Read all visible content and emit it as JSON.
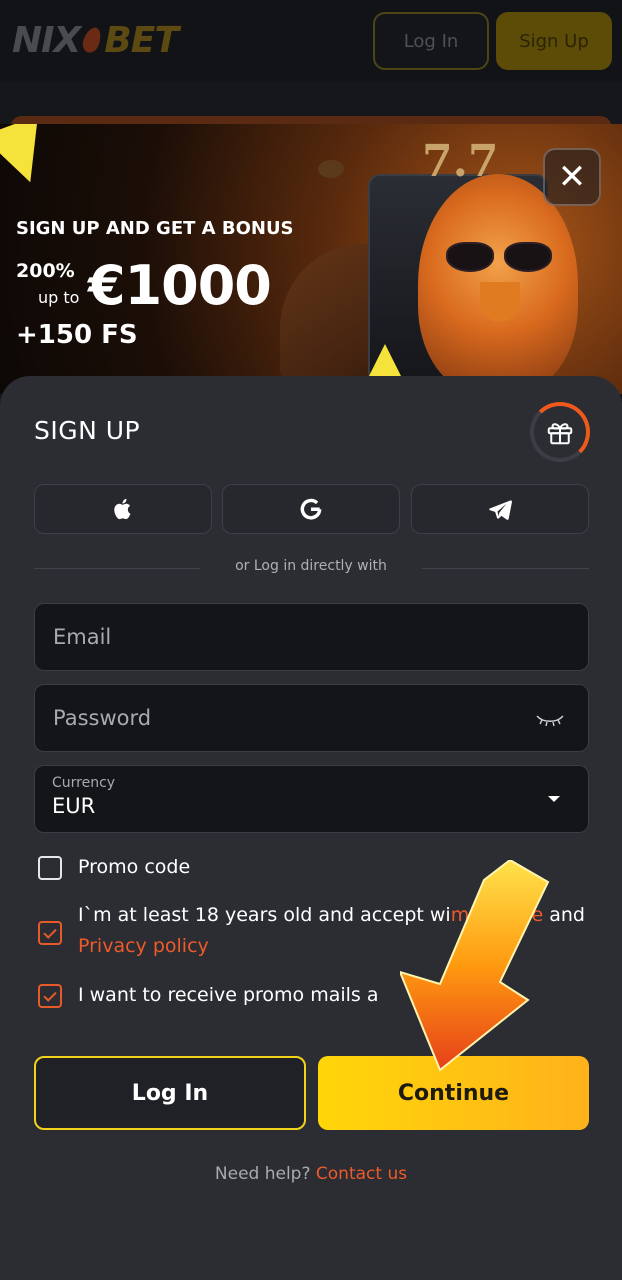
{
  "header": {
    "logo_part1": "NIX",
    "logo_part2": "BET",
    "login_label": "Log In",
    "signup_label": "Sign Up"
  },
  "banner": {
    "headline": "SIGN UP AND GET A BONUS",
    "percent": "200%",
    "up_to": "up to",
    "amount": "€1000",
    "free_spins": "+150 FS",
    "close_icon": "close-icon"
  },
  "signup": {
    "title": "SIGN UP",
    "gift_icon": "gift-icon",
    "social": [
      {
        "name": "apple",
        "icon": "apple-icon"
      },
      {
        "name": "google",
        "icon": "google-icon"
      },
      {
        "name": "telegram",
        "icon": "telegram-icon"
      }
    ],
    "divider_text": "or Log in directly with",
    "email": {
      "placeholder": "Email",
      "value": ""
    },
    "password": {
      "placeholder": "Password",
      "value": "",
      "toggle_icon": "eye-closed-icon"
    },
    "currency": {
      "label": "Currency",
      "value": "EUR"
    },
    "promo_code": {
      "label": "Promo code",
      "checked": false
    },
    "age_terms": {
      "text_before": "I`m at least 18 years old and accept wi",
      "link1": "ms of use",
      "text_mid": " and ",
      "link2": "Privacy policy",
      "checked": true
    },
    "promo_mails": {
      "label": "I want to receive promo mails a",
      "checked": true
    },
    "login_label": "Log In",
    "continue_label": "Continue",
    "help_text": "Need help?",
    "contact_link": "Contact us"
  },
  "colors": {
    "accent": "#ffd60a",
    "link": "#ee5a2a",
    "sheet_bg": "#2b2d33",
    "field_bg": "#141518"
  }
}
